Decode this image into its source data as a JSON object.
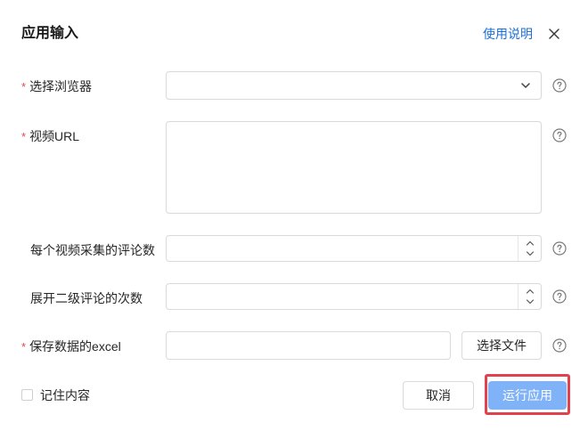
{
  "dialog": {
    "title": "应用输入",
    "help_link": "使用说明"
  },
  "form": {
    "browser": {
      "required": "*",
      "label": "选择浏览器",
      "value": ""
    },
    "video_url": {
      "required": "*",
      "label": "视频URL",
      "value": ""
    },
    "comments_per_video": {
      "label": "每个视频采集的评论数",
      "value": ""
    },
    "expand_second_level": {
      "label": "展开二级评论的次数",
      "value": ""
    },
    "save_excel": {
      "required": "*",
      "label": "保存数据的excel",
      "value": "",
      "choose_file_label": "选择文件"
    }
  },
  "footer": {
    "remember_label": "记住内容",
    "remember_checked": false,
    "cancel_label": "取消",
    "run_label": "运行应用"
  },
  "colors": {
    "link": "#1d6fd6",
    "required": "#e5484d",
    "primary_button": "#7fb2f6",
    "highlight": "#e0434f"
  },
  "icons": {
    "close": "close-icon",
    "dropdown": "chevron-down-icon",
    "help": "question-circle-icon",
    "stepper_up": "chevron-up-icon",
    "stepper_down": "chevron-down-icon"
  }
}
